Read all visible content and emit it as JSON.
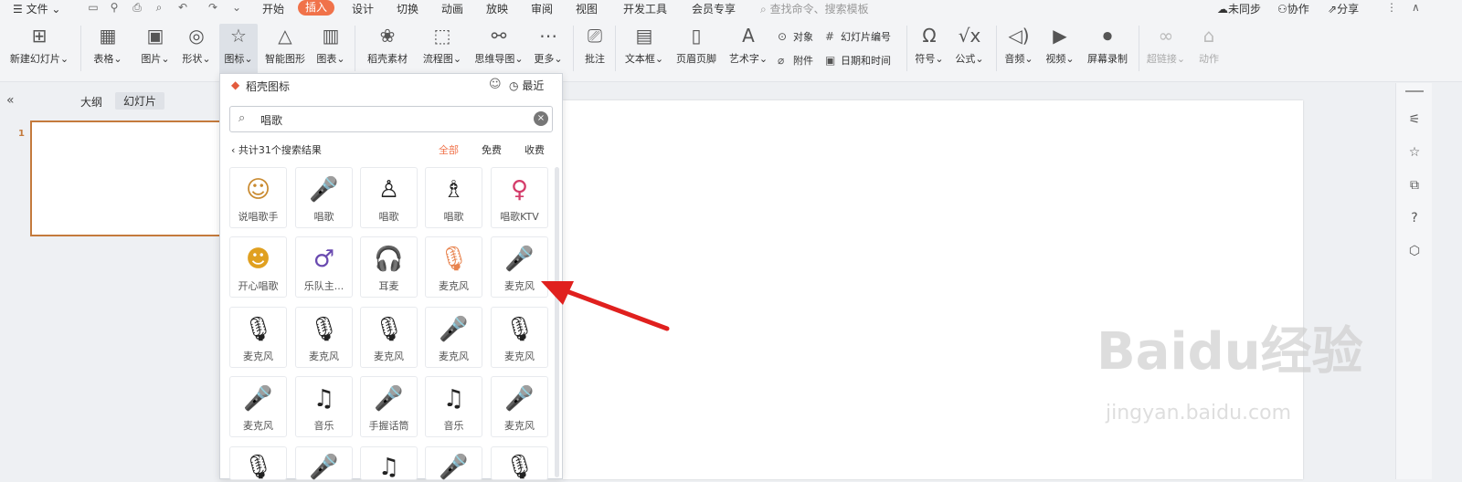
{
  "menubar": {
    "file_label": "文件",
    "tabs": [
      "开始",
      "插入",
      "设计",
      "切换",
      "动画",
      "放映",
      "审阅",
      "视图",
      "开发工具",
      "会员专享"
    ],
    "active_tab": "插入",
    "search_placeholder": "查找命令、搜索模板",
    "sync_label": "未同步",
    "collab_label": "协作",
    "share_label": "分享"
  },
  "ribbon": {
    "buttons": {
      "new_slide": "新建幻灯片",
      "table": "表格",
      "picture": "图片",
      "shape": "形状",
      "icon": "图标",
      "smartart": "智能图形",
      "chart": "图表",
      "stock": "稻壳素材",
      "flowchart": "流程图",
      "mindmap": "思维导图",
      "more": "更多",
      "comment": "批注",
      "textbox": "文本框",
      "header_footer": "页眉页脚",
      "wordart": "艺术字",
      "object": "对象",
      "slide_number": "幻灯片编号",
      "attachment": "附件",
      "datetime": "日期和时间",
      "symbol": "符号",
      "formula": "公式",
      "audio": "音频",
      "video": "视频",
      "screen_record": "屏幕录制",
      "hyperlink": "超链接",
      "action": "动作"
    }
  },
  "leftpane": {
    "tab_outline": "大纲",
    "tab_slides": "幻灯片",
    "slide_number": "1"
  },
  "panel": {
    "title": "稻壳图标",
    "recent_label": "最近",
    "search_value": "唱歌",
    "results_text": "共计31个搜索结果",
    "filters": [
      "全部",
      "免费",
      "收费"
    ],
    "active_filter": "全部",
    "items": [
      {
        "label": "说唱歌手",
        "icon": "rapper-icon"
      },
      {
        "label": "唱歌",
        "icon": "microphone-icon"
      },
      {
        "label": "唱歌",
        "icon": "singer-icon"
      },
      {
        "label": "唱歌",
        "icon": "singer-pointing-icon"
      },
      {
        "label": "唱歌KTV",
        "icon": "ktv-singer-icon"
      },
      {
        "label": "开心唱歌",
        "icon": "happy-singing-icon"
      },
      {
        "label": "乐队主...",
        "icon": "band-lead-icon"
      },
      {
        "label": "耳麦",
        "icon": "headset-icon"
      },
      {
        "label": "麦克风",
        "icon": "mic-orange-icon"
      },
      {
        "label": "麦克风",
        "icon": "dual-mic-icon"
      },
      {
        "label": "麦克风",
        "icon": "condenser-mic-icon"
      },
      {
        "label": "麦克风",
        "icon": "studio-mic-icon"
      },
      {
        "label": "麦克风",
        "icon": "studio-mic-2-icon"
      },
      {
        "label": "麦克风",
        "icon": "handheld-mic-icon"
      },
      {
        "label": "麦克风",
        "icon": "podcast-mic-icon"
      },
      {
        "label": "麦克风",
        "icon": "handheld-mic-2-icon"
      },
      {
        "label": "音乐",
        "icon": "music-dish-icon"
      },
      {
        "label": "手握话筒",
        "icon": "hand-mic-icon"
      },
      {
        "label": "音乐",
        "icon": "music-note-icon"
      },
      {
        "label": "麦克风",
        "icon": "stand-mic-icon"
      }
    ]
  },
  "watermark": {
    "brand": "Baidu经验",
    "url": "jingyan.baidu.com"
  },
  "colors": {
    "accent": "#f0724a",
    "arrow": "#e0201e",
    "thumb_border": "#c47a3c"
  }
}
